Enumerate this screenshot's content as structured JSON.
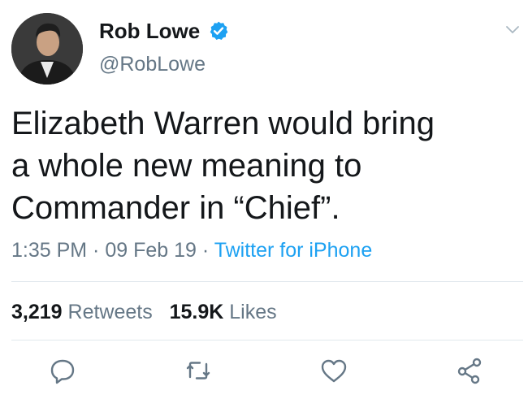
{
  "user": {
    "display_name": "Rob Lowe",
    "handle": "@RobLowe",
    "verified": true
  },
  "tweet": {
    "text": "Elizabeth Warren would bring\na whole new meaning to\nCommander in “Chief”.",
    "time": "1:35 PM",
    "separator": " · ",
    "date": "09 Feb 19",
    "source": "Twitter for iPhone"
  },
  "stats": {
    "retweets_count": "3,219",
    "retweets_label": "Retweets",
    "likes_count": "15.9K",
    "likes_label": "Likes"
  },
  "icons": {
    "verified": "verified-badge-icon",
    "caret": "chevron-down-icon",
    "reply": "reply-icon",
    "retweet": "retweet-icon",
    "like": "heart-icon",
    "share": "share-icon"
  },
  "colors": {
    "accent": "#1da1f2",
    "muted": "#657786",
    "text": "#14171a",
    "divider": "#e1e8ed"
  }
}
